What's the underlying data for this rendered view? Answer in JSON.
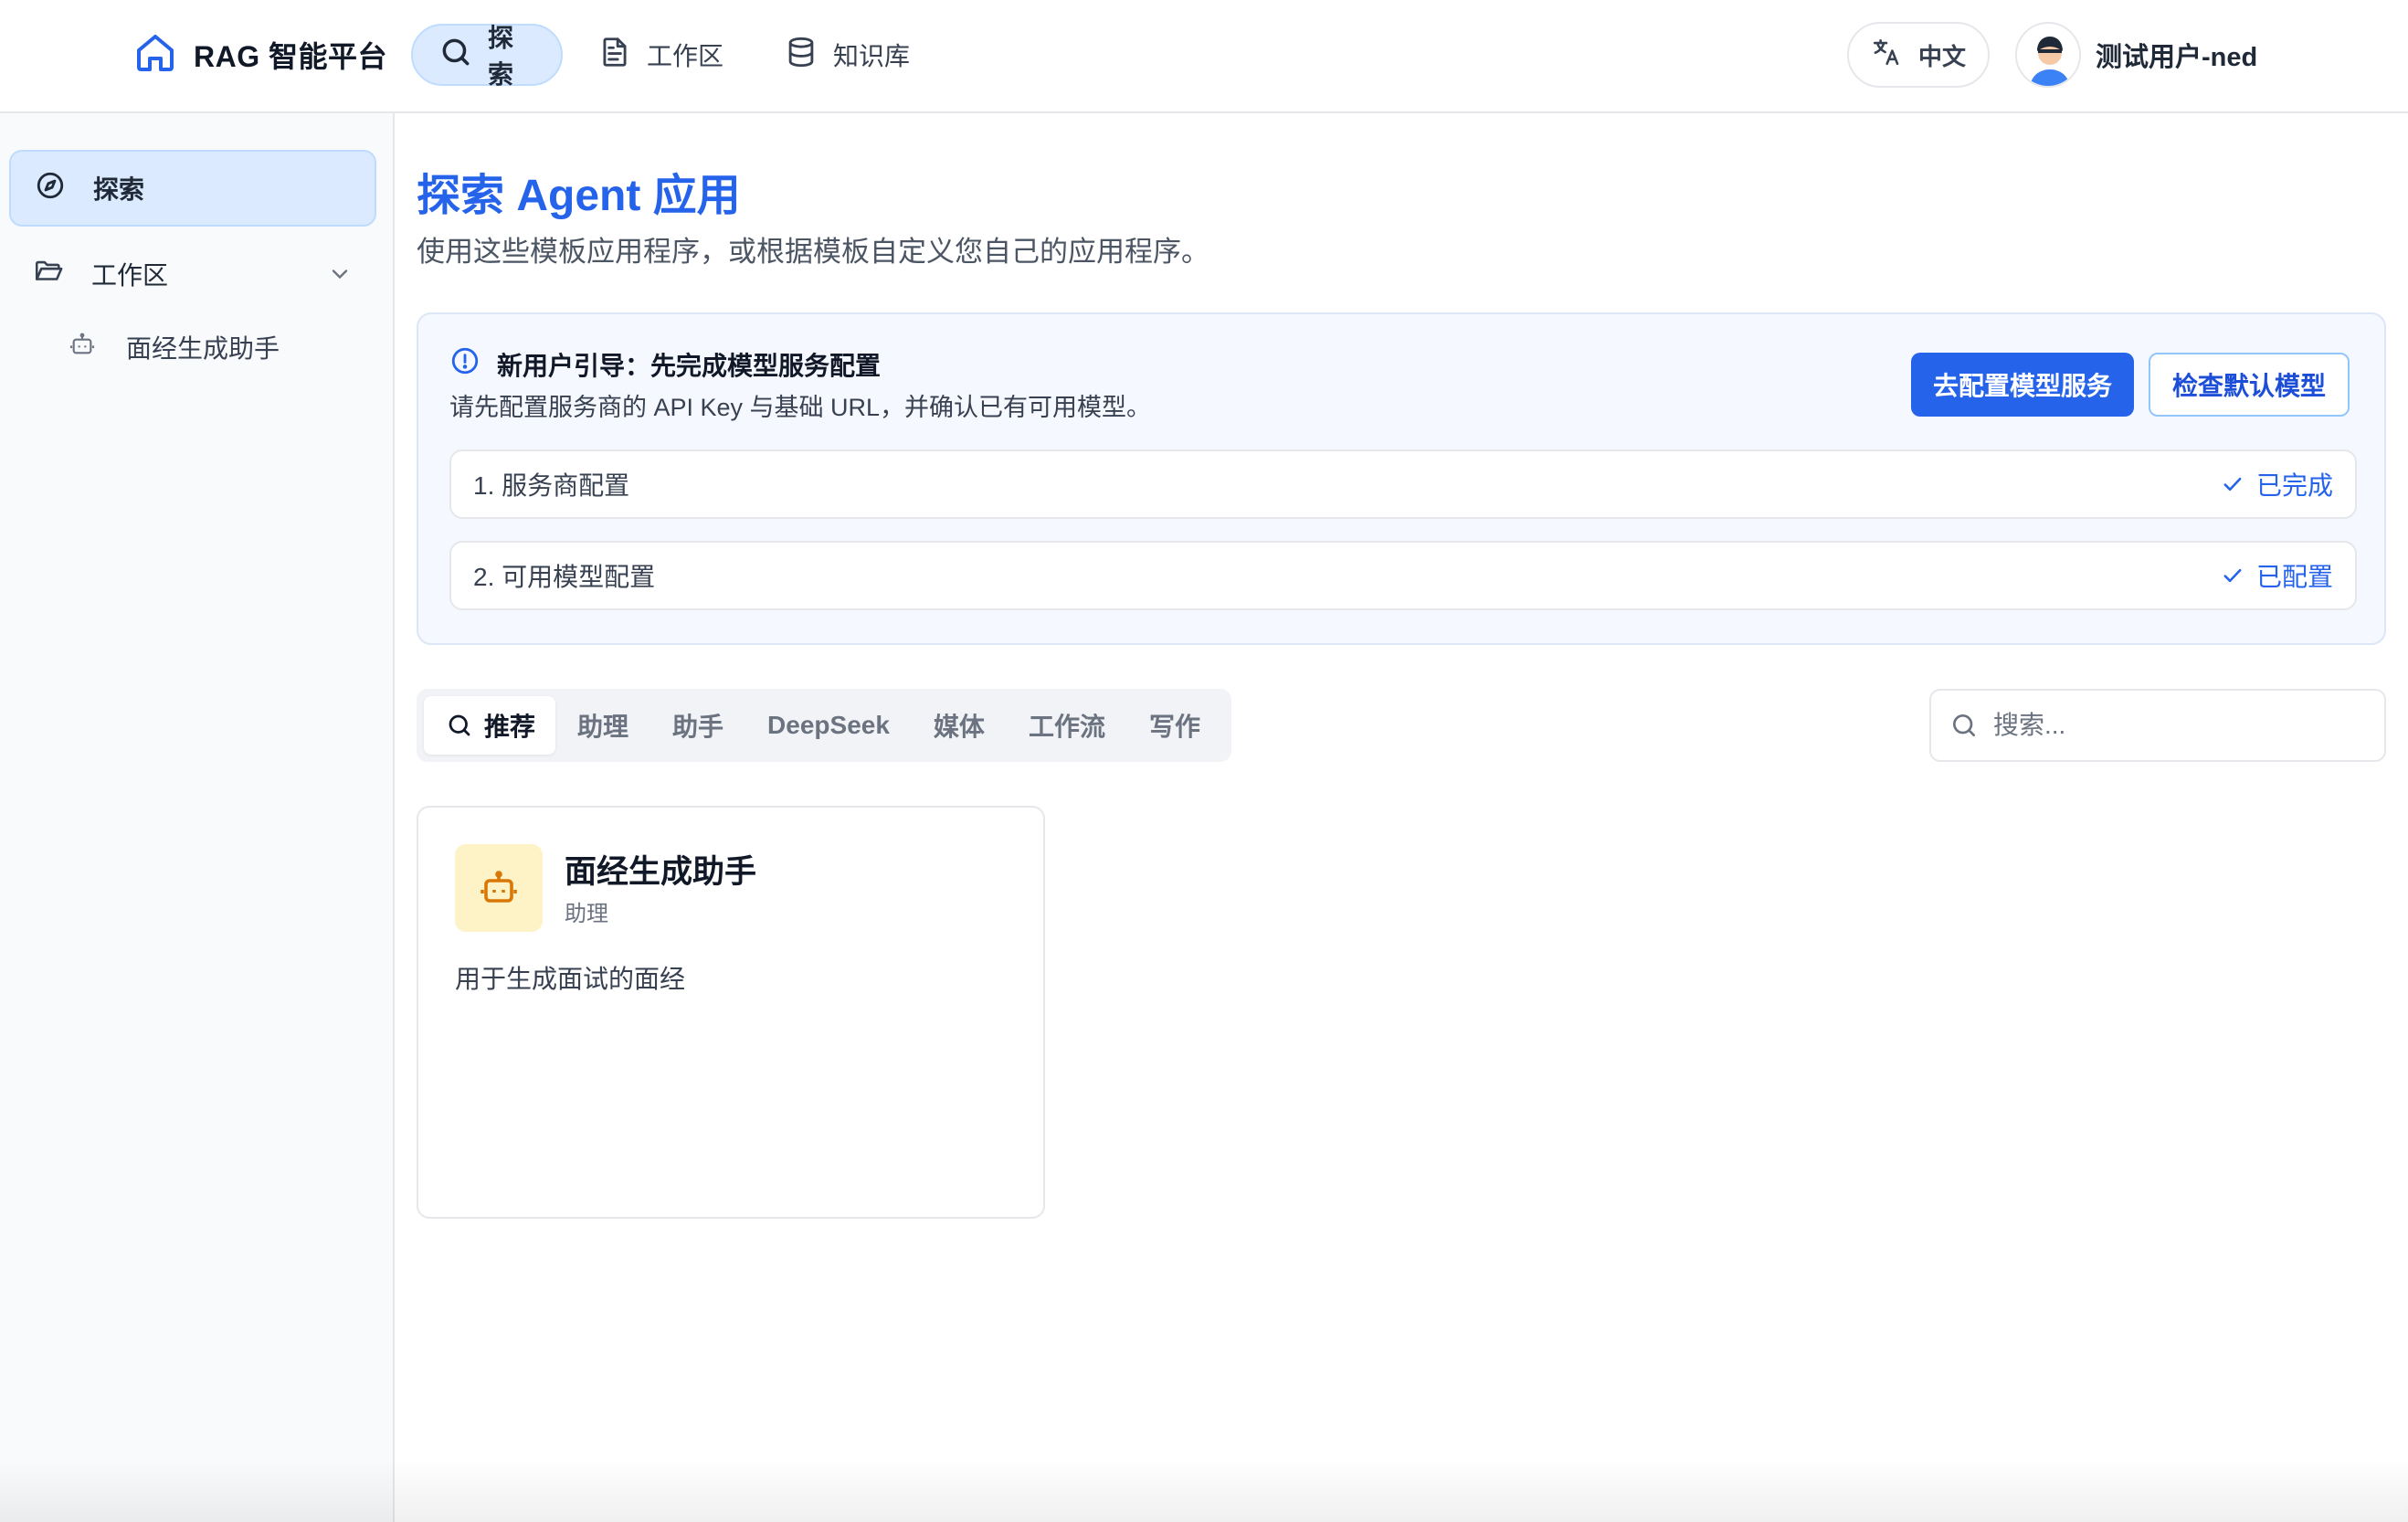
{
  "header": {
    "brand": "RAG 智能平台",
    "nav": [
      {
        "label": "探索",
        "icon": "search-icon"
      },
      {
        "label": "工作区",
        "icon": "document-icon"
      },
      {
        "label": "知识库",
        "icon": "database-icon"
      }
    ],
    "language": "中文",
    "user_name": "测试用户-ned"
  },
  "sidebar": {
    "items": [
      {
        "label": "探索",
        "icon": "compass-icon"
      },
      {
        "label": "工作区",
        "icon": "folder-icon"
      }
    ],
    "sub_items": [
      {
        "label": "面经生成助手",
        "icon": "bot-icon"
      }
    ]
  },
  "main": {
    "title": "探索 Agent 应用",
    "subtitle": "使用这些模板应用程序，或根据模板自定义您自己的应用程序。"
  },
  "guide": {
    "title": "新用户引导：先完成模型服务配置",
    "description": "请先配置服务商的 API Key 与基础 URL，并确认已有可用模型。",
    "primary_button": "去配置模型服务",
    "secondary_button": "检查默认模型",
    "steps": [
      {
        "label": "1. 服务商配置",
        "status": "已完成"
      },
      {
        "label": "2. 可用模型配置",
        "status": "已配置"
      }
    ]
  },
  "tabs": [
    "推荐",
    "助理",
    "助手",
    "DeepSeek",
    "媒体",
    "工作流",
    "写作"
  ],
  "search": {
    "placeholder": "搜索..."
  },
  "cards": [
    {
      "title": "面经生成助手",
      "category": "助理",
      "description": "用于生成面试的面经",
      "icon": "bot-icon"
    }
  ],
  "colors": {
    "accent": "#2563eb",
    "accent_light": "#dbeafe",
    "card_icon_bg": "#fef3c7",
    "card_icon": "#d97706"
  }
}
